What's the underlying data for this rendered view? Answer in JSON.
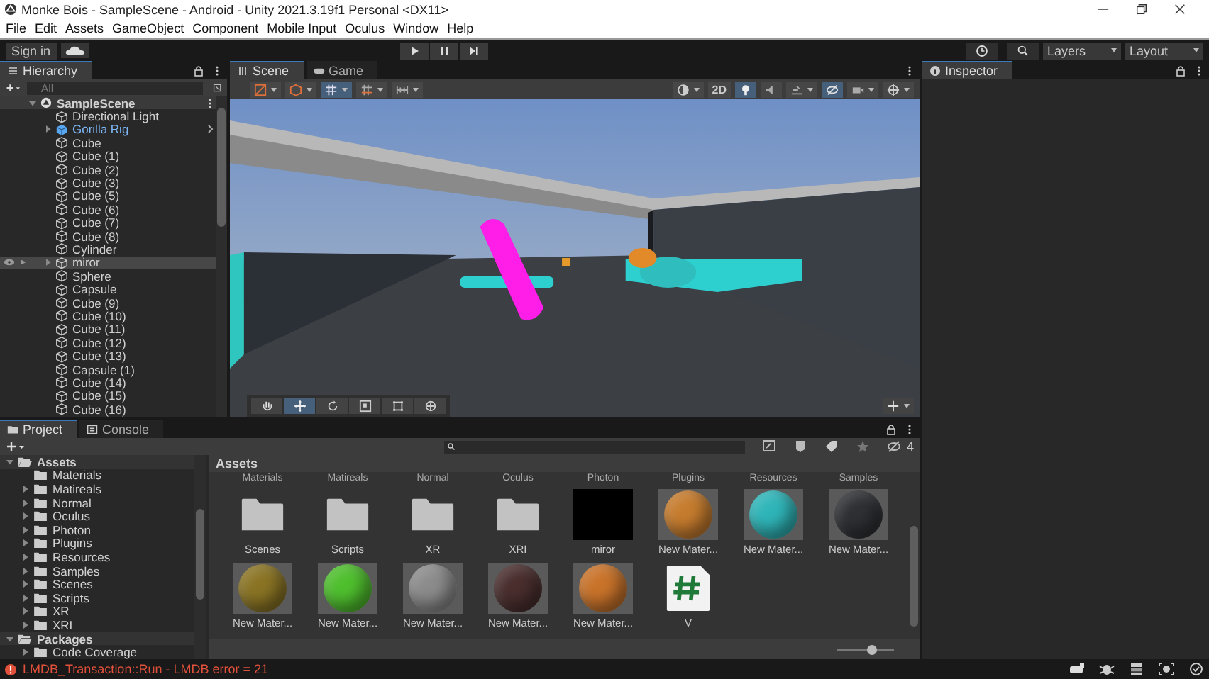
{
  "window": {
    "title": "Monke Bois - SampleScene - Android - Unity 2021.3.19f1 Personal <DX11>"
  },
  "menu": [
    "File",
    "Edit",
    "Assets",
    "GameObject",
    "Component",
    "Mobile Input",
    "Oculus",
    "Window",
    "Help"
  ],
  "toolbar": {
    "sign_in": "Sign in",
    "layers": "Layers",
    "layout": "Layout"
  },
  "hierarchy": {
    "tab": {
      "label": "Hierarchy",
      "selected": true
    },
    "search": {
      "placeholder": "All"
    },
    "scene": {
      "name": "SampleScene",
      "kind": "scene",
      "expanded": true,
      "children": [
        {
          "name": "Directional Light",
          "kind": "object"
        },
        {
          "name": "Gorilla Rig",
          "kind": "prefab",
          "expanded": false
        },
        {
          "name": "Cube",
          "kind": "object"
        },
        {
          "name": "Cube (1)",
          "kind": "object"
        },
        {
          "name": "Cube (2)",
          "kind": "object"
        },
        {
          "name": "Cube (3)",
          "kind": "object"
        },
        {
          "name": "Cube (5)",
          "kind": "object"
        },
        {
          "name": "Cube (6)",
          "kind": "object"
        },
        {
          "name": "Cube (7)",
          "kind": "object"
        },
        {
          "name": "Cube (8)",
          "kind": "object"
        },
        {
          "name": "Cylinder",
          "kind": "object"
        },
        {
          "name": "miror",
          "kind": "object",
          "expanded": false,
          "highlighted": true
        },
        {
          "name": "Sphere",
          "kind": "object"
        },
        {
          "name": "Capsule",
          "kind": "object"
        },
        {
          "name": "Cube (9)",
          "kind": "object"
        },
        {
          "name": "Cube (10)",
          "kind": "object"
        },
        {
          "name": "Cube (11)",
          "kind": "object"
        },
        {
          "name": "Cube (12)",
          "kind": "object"
        },
        {
          "name": "Cube (13)",
          "kind": "object"
        },
        {
          "name": "Capsule (1)",
          "kind": "object"
        },
        {
          "name": "Cube (14)",
          "kind": "object"
        },
        {
          "name": "Cube (15)",
          "kind": "object"
        },
        {
          "name": "Cube (16)",
          "kind": "object"
        }
      ]
    }
  },
  "scene_view": {
    "tabs": [
      {
        "label": "Scene",
        "selected": true
      },
      {
        "label": "Game",
        "selected": false
      }
    ],
    "left_tools": [
      {
        "kind": "draw",
        "selected": false
      },
      {
        "kind": "render",
        "selected": false
      },
      {
        "kind": "grid",
        "selected": true
      },
      {
        "kind": "snap",
        "selected": false
      },
      {
        "kind": "align",
        "selected": false
      }
    ],
    "right_tools": [
      {
        "kind": "shading",
        "selected": false
      },
      {
        "kind": "text",
        "label": "2D",
        "selected": false
      },
      {
        "kind": "light",
        "selected": true
      },
      {
        "kind": "audio",
        "selected": false
      },
      {
        "kind": "effects",
        "selected": false
      },
      {
        "kind": "hidden",
        "selected": true
      },
      {
        "kind": "camera",
        "selected": false
      },
      {
        "kind": "gizmos",
        "selected": false
      }
    ],
    "tools": [
      {
        "kind": "hand",
        "selected": false
      },
      {
        "kind": "move",
        "selected": true
      },
      {
        "kind": "rotate",
        "selected": false
      },
      {
        "kind": "scale",
        "selected": false
      },
      {
        "kind": "rect",
        "selected": false
      },
      {
        "kind": "transform",
        "selected": false
      }
    ]
  },
  "inspector": {
    "tab": {
      "label": "Inspector",
      "selected": true
    }
  },
  "project": {
    "tabs": [
      {
        "label": "Project",
        "selected": true
      },
      {
        "label": "Console",
        "selected": false
      }
    ],
    "hidden_packages": "4",
    "tree": [
      {
        "name": "Assets",
        "expanded": true,
        "children": [
          {
            "name": "Materials"
          },
          {
            "name": "Matireals",
            "expanded": false
          },
          {
            "name": "Normal",
            "expanded": false
          },
          {
            "name": "Oculus",
            "expanded": false
          },
          {
            "name": "Photon",
            "expanded": false
          },
          {
            "name": "Plugins",
            "expanded": false
          },
          {
            "name": "Resources",
            "expanded": false
          },
          {
            "name": "Samples",
            "expanded": false
          },
          {
            "name": "Scenes",
            "expanded": false
          },
          {
            "name": "Scripts",
            "expanded": false
          },
          {
            "name": "XR",
            "expanded": false
          },
          {
            "name": "XRI",
            "expanded": false
          }
        ]
      },
      {
        "name": "Packages",
        "expanded": true,
        "children": [
          {
            "name": "Code Coverage",
            "expanded": false
          }
        ]
      }
    ],
    "breadcrumb": "Assets",
    "row_above": [
      "Materials",
      "Matireals",
      "Normal",
      "Oculus",
      "Photon",
      "Plugins",
      "Resources",
      "Samples"
    ],
    "items": [
      {
        "name": "Scenes",
        "kind": "folder"
      },
      {
        "name": "Scripts",
        "kind": "folder"
      },
      {
        "name": "XR",
        "kind": "folder"
      },
      {
        "name": "XRI",
        "kind": "folder"
      },
      {
        "name": "miror",
        "kind": "texture"
      },
      {
        "name": "New Mater...",
        "kind": "material",
        "color": "#c67c2e"
      },
      {
        "name": "New Mater...",
        "kind": "material",
        "color": "#2fb5b8"
      },
      {
        "name": "New Mater...",
        "kind": "material",
        "color": "#2e3034"
      },
      {
        "name": "New Mater...",
        "kind": "material",
        "color": "#8a7424"
      },
      {
        "name": "New Mater...",
        "kind": "material",
        "color": "#4fbf2e"
      },
      {
        "name": "New Mater...",
        "kind": "material",
        "color": "#8c8c8c"
      },
      {
        "name": "New Mater...",
        "kind": "material",
        "color": "#4a2e2e"
      },
      {
        "name": "New Mater...",
        "kind": "material",
        "color": "#c9732a"
      },
      {
        "name": "V",
        "kind": "script"
      }
    ],
    "zoom": {
      "level": 0.6
    }
  },
  "status": {
    "kind": "error",
    "message": "LMDB_Transaction::Run - LMDB error = 21"
  }
}
